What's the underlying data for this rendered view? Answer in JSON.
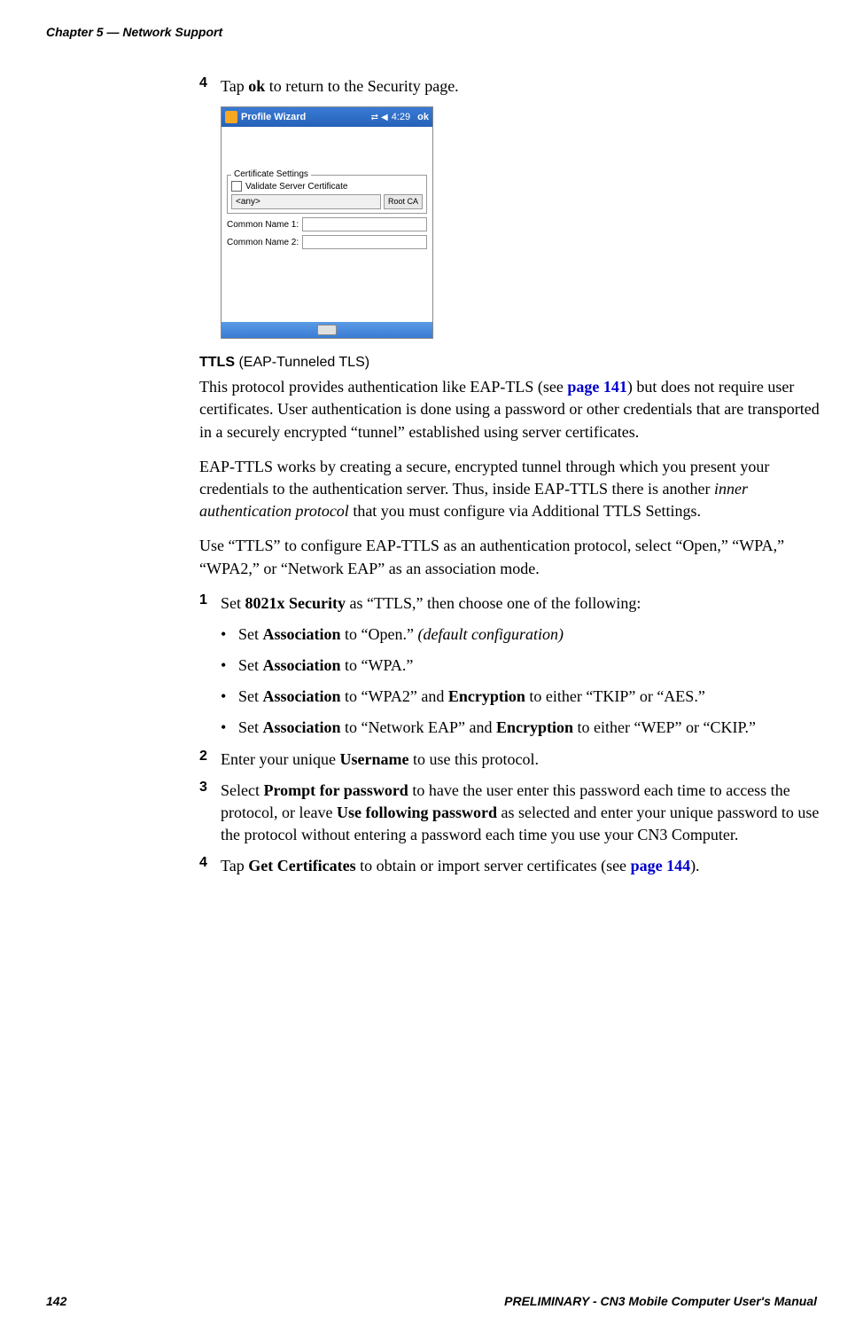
{
  "header": {
    "chapter": "Chapter 5 — Network Support"
  },
  "step4a": {
    "num": "4",
    "text_prefix": "Tap ",
    "text_bold": "ok",
    "text_suffix": " to return to the Security page."
  },
  "screenshot": {
    "title": "Profile Wizard",
    "time": "4:29",
    "ok": "ok",
    "cert_legend": "Certificate Settings",
    "validate_label": "Validate Server Certificate",
    "dropdown_value": "<any>",
    "root_ca_button": "Root CA",
    "common_name_1": "Common Name 1:",
    "common_name_2": "Common Name 2:"
  },
  "ttls_heading": {
    "bold": "TTLS",
    "rest": " (EAP-Tunneled TLS)"
  },
  "para1": {
    "p1": "This protocol provides authentication like EAP-TLS (see ",
    "link": "page 141",
    "p2": ") but does not require user certificates. User authentication is done using a password or other credentials that are transported in a securely encrypted “tunnel” established using server certificates."
  },
  "para2": {
    "p1": "EAP-TTLS works by creating a secure, encrypted tunnel through which you present your credentials to the authentication server. Thus, inside EAP-TTLS there is another ",
    "italic": "inner authentication protocol",
    "p2": " that you must configure via Additional TTLS Settings."
  },
  "para3": "Use “TTLS” to configure EAP-TTLS as an authentication protocol, select “Open,” “WPA,” “WPA2,” or “Network EAP” as an association mode.",
  "step1": {
    "num": "1",
    "p1": "Set ",
    "b1": "8021x Security",
    "p2": " as “TTLS,” then choose one of the following:"
  },
  "bullets": {
    "b1": {
      "p1": "Set ",
      "bold1": "Association",
      "p2": " to “Open.” ",
      "italic": "(default configuration)"
    },
    "b2": {
      "p1": "Set ",
      "bold1": "Association",
      "p2": " to “WPA.”"
    },
    "b3": {
      "p1": "Set ",
      "bold1": "Association",
      "p2": " to “WPA2” and ",
      "bold2": "Encryption",
      "p3": " to either “TKIP” or “AES.”"
    },
    "b4": {
      "p1": "Set ",
      "bold1": "Association",
      "p2": " to “Network EAP” and ",
      "bold2": "Encryption",
      "p3": " to either “WEP” or “CKIP.”"
    }
  },
  "step2": {
    "num": "2",
    "p1": "Enter your unique ",
    "bold1": "Username",
    "p2": " to use this protocol."
  },
  "step3": {
    "num": "3",
    "p1": "Select ",
    "bold1": "Prompt for password",
    "p2": " to have the user enter this password each time to access the protocol, or leave ",
    "bold2": "Use following password",
    "p3": " as selected and enter your unique password to use the protocol without entering a password each time you use your CN3 Computer."
  },
  "step4b": {
    "num": "4",
    "p1": "Tap ",
    "bold1": "Get Certificates",
    "p2": " to obtain or import server certificates (see ",
    "link": "page 144",
    "p3": ")."
  },
  "footer": {
    "page_num": "142",
    "manual_title": "PRELIMINARY - CN3 Mobile Computer User's Manual"
  }
}
